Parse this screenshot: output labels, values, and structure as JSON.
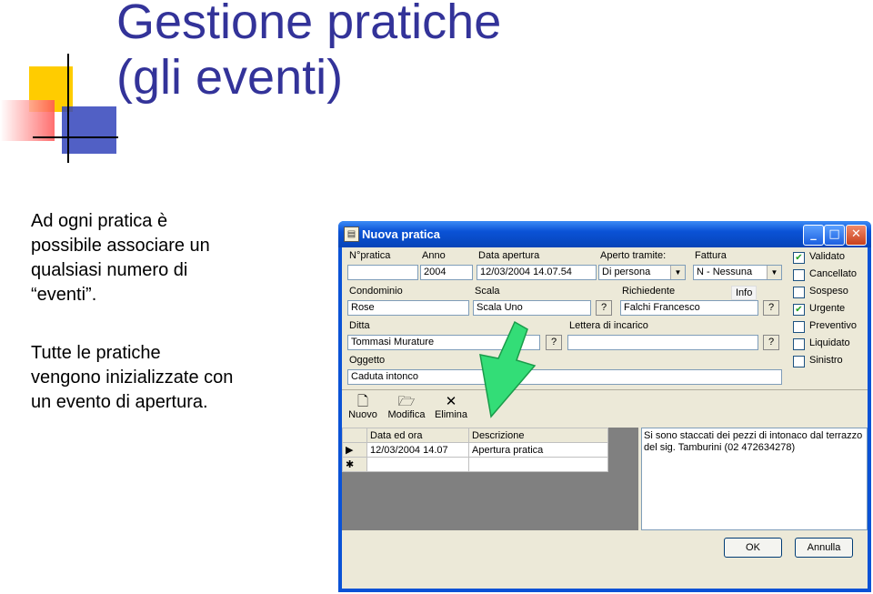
{
  "slide": {
    "title_line1": "Gestione pratiche",
    "title_line2": "(gli eventi)",
    "paragraph1": [
      "Ad ogni pratica è",
      "possibile associare un",
      "qualsiasi numero di",
      "“eventi”."
    ],
    "paragraph2": [
      "Tutte le pratiche",
      "vengono inizializzate con",
      "un evento di apertura."
    ]
  },
  "window": {
    "title": "Nuova pratica",
    "minimize": "_",
    "maximize": "□",
    "close": "✕"
  },
  "form": {
    "n_pratica_label": "N°pratica",
    "n_pratica_value": "",
    "anno_label": "Anno",
    "anno_value": "2004",
    "data_apertura_label": "Data apertura",
    "data_apertura_value": "12/03/2004 14.07.54",
    "aperto_tramite_label": "Aperto tramite:",
    "aperto_tramite_value": "Di persona",
    "fattura_label": "Fattura",
    "fattura_value": "N - Nessuna",
    "condominio_label": "Condominio",
    "condominio_value": "Rose",
    "scala_label": "Scala",
    "scala_value": "Scala Uno",
    "richiedente_label": "Richiedente",
    "richiedente_value": "Falchi Francesco",
    "info_label": "Info",
    "ditta_label": "Ditta",
    "ditta_value": "Tommasi Murature",
    "lettera_label": "Lettera di incarico",
    "lettera_value": "",
    "oggetto_label": "Oggetto",
    "oggetto_value": "Caduta intonco",
    "question": "?"
  },
  "checkboxes": [
    {
      "label": "Validato",
      "checked": true
    },
    {
      "label": "Cancellato",
      "checked": false
    },
    {
      "label": "Sospeso",
      "checked": false
    },
    {
      "label": "Urgente",
      "checked": true
    },
    {
      "label": "Preventivo",
      "checked": false
    },
    {
      "label": "Liquidato",
      "checked": false
    },
    {
      "label": "Sinistro",
      "checked": false
    }
  ],
  "toolbar": {
    "nuovo": "Nuovo",
    "modifica": "Modifica",
    "elimina": "Elimina"
  },
  "events_grid": {
    "columns": [
      "Data ed ora",
      "Descrizione"
    ],
    "rows": [
      {
        "marker": "▶",
        "data": "12/03/2004 14.07",
        "descrizione": "Apertura pratica"
      },
      {
        "marker": "✱",
        "data": "",
        "descrizione": ""
      }
    ]
  },
  "note": "Si sono staccati dei pezzi di intonaco dal terrazzo del sig. Tamburini (02 472634278)",
  "buttons": {
    "ok": "OK",
    "annulla": "Annulla"
  },
  "colors": {
    "title": "#333399",
    "titlebar": "#0a52d6",
    "window_bg": "#ece9d8",
    "arrow": "#33dd77"
  }
}
